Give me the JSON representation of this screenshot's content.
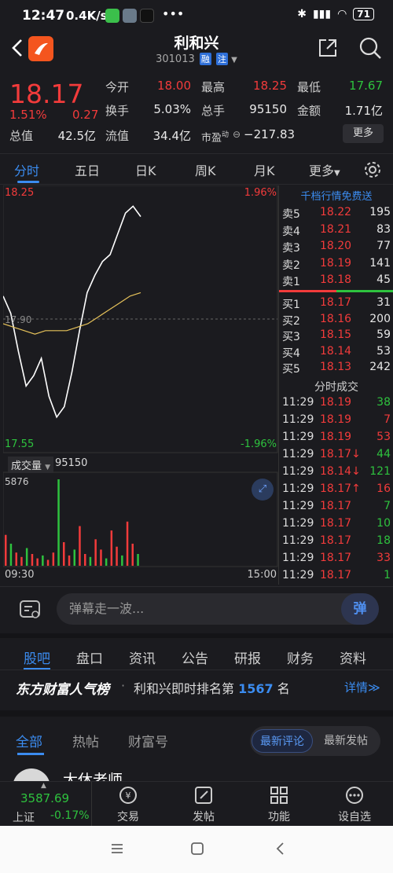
{
  "status": {
    "time": "12:47",
    "network": "0.4K/s",
    "battery": "71"
  },
  "header": {
    "title": "利和兴",
    "code": "301013",
    "tag1": "融",
    "tag2": "注"
  },
  "quote": {
    "price": "18.17",
    "change_pct": "1.51%",
    "change": "0.27",
    "open_label": "今开",
    "open": "18.00",
    "high_label": "最高",
    "high": "18.25",
    "low_label": "最低",
    "low": "17.67",
    "turnover_label": "换手",
    "turnover": "5.03%",
    "volume_label": "总手",
    "volume": "95150",
    "amount_label": "金额",
    "amount": "1.71亿",
    "mktcap_label": "总值",
    "mktcap": "42.5亿",
    "float_label": "流值",
    "float": "34.4亿",
    "pe_label": "市盈",
    "pe_sup": "动",
    "pe": "−217.83",
    "more": "更多"
  },
  "chart_tabs": [
    "分时",
    "五日",
    "日K",
    "周K",
    "月K",
    "更多"
  ],
  "chart": {
    "high_price": "18.25",
    "high_pct": "1.96%",
    "low_price": "17.55",
    "low_pct": "-1.96%",
    "mid_price": "17.90",
    "vol_label": "成交量",
    "vol_value": "95150",
    "vol_max": "5876",
    "time_start": "09:30",
    "time_end": "15:00"
  },
  "chart_data": {
    "type": "line",
    "title": "",
    "xlabel": "",
    "ylabel": "",
    "x_range": [
      "09:30",
      "11:29"
    ],
    "ylim": [
      17.55,
      18.25
    ],
    "series": [
      {
        "values": [
          17.98,
          17.93,
          17.82,
          17.72,
          17.75,
          17.8,
          17.69,
          17.63,
          17.66,
          17.76,
          17.88,
          17.99,
          18.04,
          18.08,
          18.1,
          18.16,
          18.22,
          18.24,
          18.21
        ]
      },
      {
        "values": [
          17.9,
          17.89,
          17.88,
          17.87,
          17.88,
          17.88,
          17.88,
          17.89,
          17.9,
          17.92,
          17.94,
          17.96,
          17.98,
          17.99
        ]
      }
    ],
    "volume": [
      2100,
      1500,
      900,
      600,
      1200,
      800,
      500,
      700,
      400,
      900,
      5876,
      1600,
      700,
      1100,
      2700,
      800,
      600,
      1800,
      1100,
      500,
      2400,
      1300,
      700,
      3000,
      1500,
      800
    ]
  },
  "book": {
    "title": "千档行情免费送",
    "asks": [
      {
        "label": "卖5",
        "price": "18.22",
        "vol": "195"
      },
      {
        "label": "卖4",
        "price": "18.21",
        "vol": "83"
      },
      {
        "label": "卖3",
        "price": "18.20",
        "vol": "77"
      },
      {
        "label": "卖2",
        "price": "18.19",
        "vol": "141"
      },
      {
        "label": "卖1",
        "price": "18.18",
        "vol": "45"
      }
    ],
    "bids": [
      {
        "label": "买1",
        "price": "18.17",
        "vol": "31"
      },
      {
        "label": "买2",
        "price": "18.16",
        "vol": "200"
      },
      {
        "label": "买3",
        "price": "18.15",
        "vol": "59"
      },
      {
        "label": "买4",
        "price": "18.14",
        "vol": "53"
      },
      {
        "label": "买5",
        "price": "18.13",
        "vol": "242"
      }
    ],
    "ticks_title": "分时成交",
    "ticks": [
      {
        "time": "11:29",
        "price": "18.19",
        "vol": "38",
        "vc": "green"
      },
      {
        "time": "11:29",
        "price": "18.19",
        "vol": "7",
        "vc": "red"
      },
      {
        "time": "11:29",
        "price": "18.19",
        "vol": "53",
        "vc": "red"
      },
      {
        "time": "11:29",
        "price": "18.17↓",
        "vol": "44",
        "vc": "green"
      },
      {
        "time": "11:29",
        "price": "18.14↓",
        "vol": "121",
        "vc": "green"
      },
      {
        "time": "11:29",
        "price": "18.17↑",
        "vol": "16",
        "vc": "red"
      },
      {
        "time": "11:29",
        "price": "18.17",
        "vol": "7",
        "vc": "green"
      },
      {
        "time": "11:29",
        "price": "18.17",
        "vol": "10",
        "vc": "green"
      },
      {
        "time": "11:29",
        "price": "18.17",
        "vol": "18",
        "vc": "green"
      },
      {
        "time": "11:29",
        "price": "18.17",
        "vol": "33",
        "vc": "red"
      },
      {
        "time": "11:29",
        "price": "18.17",
        "vol": "1",
        "vc": "green"
      }
    ]
  },
  "comment": {
    "placeholder": "弹幕走一波...",
    "button": "弹"
  },
  "section_tabs": [
    "股吧",
    "盘口",
    "资讯",
    "公告",
    "研报",
    "财务",
    "资料"
  ],
  "rank": {
    "brand": "东方财富人气榜",
    "text": "利和兴即时排名第",
    "num": "1567",
    "unit": "名",
    "detail": "详情≫"
  },
  "forum_tabs": [
    "全部",
    "热帖",
    "财富号"
  ],
  "sort": [
    "最新评论",
    "最新发帖"
  ],
  "post": {
    "author": "大休老师"
  },
  "index": {
    "value": "3587.69",
    "name": "上证",
    "change": "-0.17%"
  },
  "bottom_nav": [
    "交易",
    "发帖",
    "功能",
    "设自选"
  ],
  "colors": {
    "up": "#f23b3b",
    "down": "#2ec23e",
    "accent": "#3b8cf0",
    "avg_line": "#e6c25a"
  }
}
